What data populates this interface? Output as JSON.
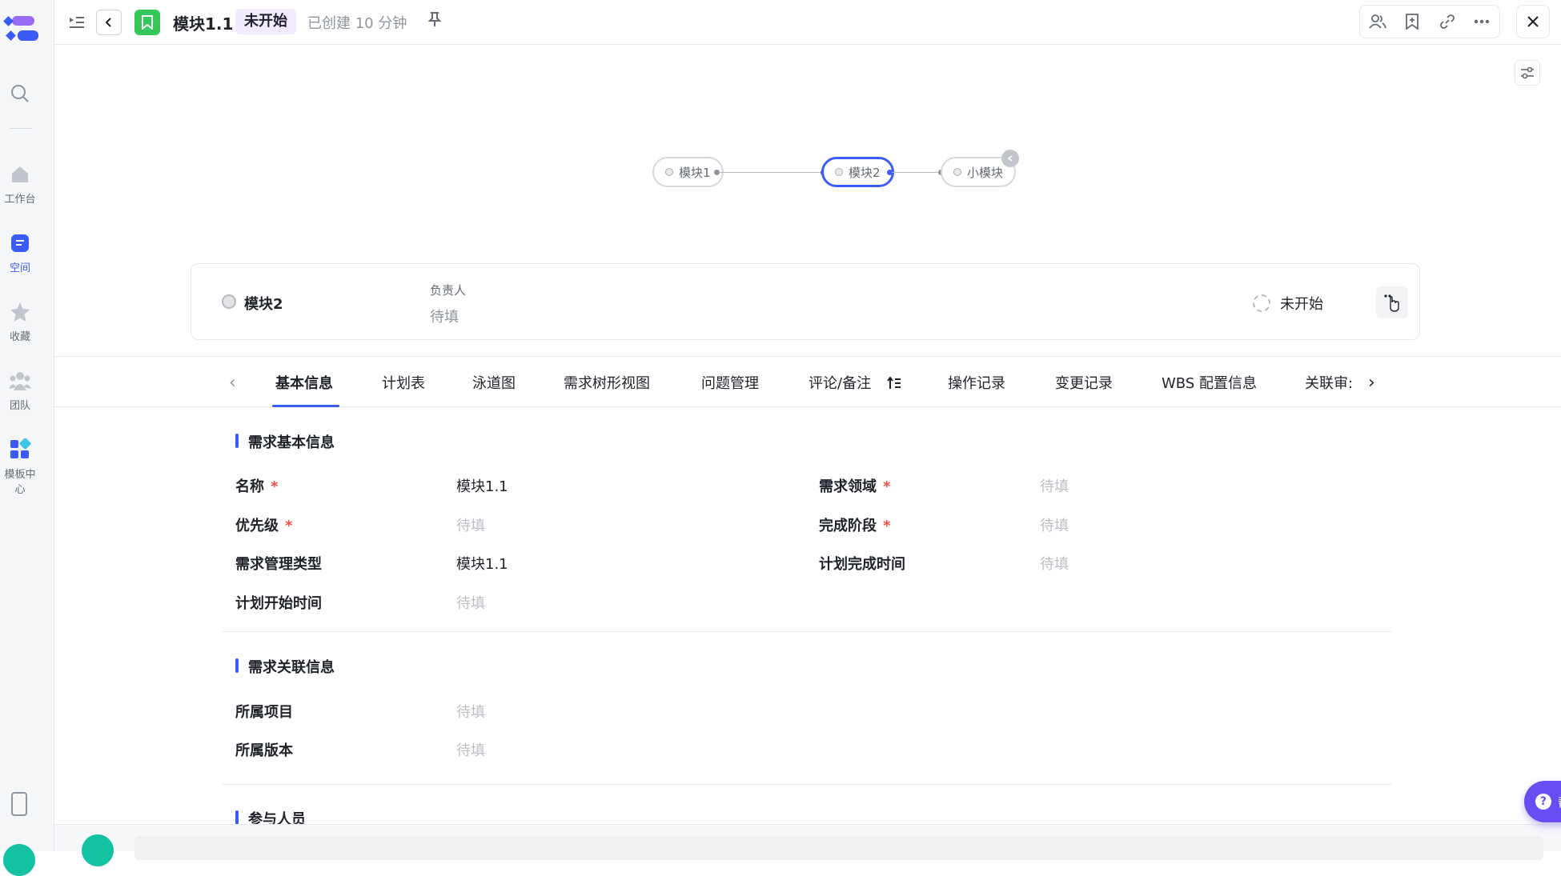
{
  "sidebar": {
    "items": [
      {
        "label": "工作台",
        "icon": "home-icon"
      },
      {
        "label": "空间",
        "icon": "space-icon",
        "active": true
      },
      {
        "label": "收藏",
        "icon": "star-icon"
      },
      {
        "label": "团队",
        "icon": "team-icon"
      },
      {
        "label": "模板中心",
        "icon": "template-icon"
      }
    ]
  },
  "header": {
    "title": "模块1.1",
    "status": "未开始",
    "created": "已创建 10 分钟"
  },
  "flow": {
    "nodes": [
      "模块1",
      "模块2",
      "小模块"
    ]
  },
  "card": {
    "name": "模块2",
    "owner_label": "负责人",
    "owner_value": "待填",
    "status": "未开始"
  },
  "tabs": [
    "基本信息",
    "计划表",
    "泳道图",
    "需求树形视图",
    "问题管理",
    "评论/备注",
    "操作记录",
    "变更记录",
    "WBS 配置信息",
    "关联审:"
  ],
  "sections": {
    "basic_title": "需求基本信息",
    "basic_fields": {
      "name_label": "名称",
      "name_value": "模块1.1",
      "domain_label": "需求领域",
      "domain_value": "待填",
      "priority_label": "优先级",
      "priority_value": "待填",
      "stage_label": "完成阶段",
      "stage_value": "待填",
      "type_label": "需求管理类型",
      "type_value": "模块1.1",
      "plan_end_label": "计划完成时间",
      "plan_end_value": "待填",
      "plan_start_label": "计划开始时间",
      "plan_start_value": "待填"
    },
    "relation_title": "需求关联信息",
    "relation_fields": {
      "project_label": "所属项目",
      "project_value": "待填",
      "version_label": "所属版本",
      "version_value": "待填"
    },
    "members_title": "参与人员"
  },
  "help": {
    "label": "帮助"
  },
  "colors": {
    "accent": "#3b5bf6",
    "help": "#6a4cf5",
    "status_chip": "#f2eafe",
    "app_badge": "#34c759",
    "required": "#f54a45"
  }
}
